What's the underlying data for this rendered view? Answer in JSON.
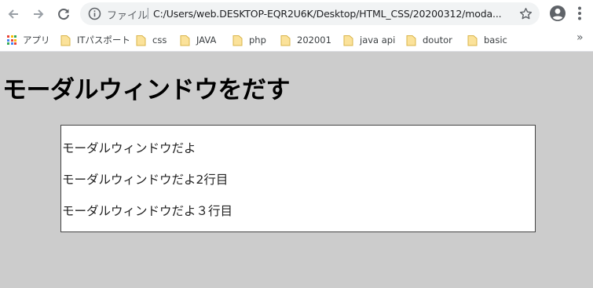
{
  "browser": {
    "omnibox": {
      "scheme_label": "ファイル",
      "separator": "|",
      "url": "C:/Users/web.DESKTOP-EQR2U6K/Desktop/HTML_CSS/20200312/moda..."
    },
    "bookmarks": [
      {
        "label": "アプリ",
        "icon": "apps-grid-icon"
      },
      {
        "label": "ITパスポート",
        "icon": "folder-icon"
      },
      {
        "label": "css",
        "icon": "folder-icon"
      },
      {
        "label": "JAVA",
        "icon": "folder-icon"
      },
      {
        "label": "php",
        "icon": "folder-icon"
      },
      {
        "label": "202001",
        "icon": "folder-icon"
      },
      {
        "label": "java api",
        "icon": "folder-icon"
      },
      {
        "label": "doutor",
        "icon": "folder-icon"
      },
      {
        "label": "basic",
        "icon": "folder-icon"
      }
    ],
    "bookmarks_overflow": "»"
  },
  "page": {
    "title": "モーダルウィンドウをだす",
    "modal_lines": [
      "モーダルウィンドウだよ",
      "モーダルウィンドウだよ2行目",
      "モーダルウィンドウだよ３行目"
    ]
  },
  "colors": {
    "page_background": "#cccccc",
    "modal_background": "#ffffff",
    "folder_fill": "#fbe29a",
    "folder_stroke": "#d9b44a"
  }
}
